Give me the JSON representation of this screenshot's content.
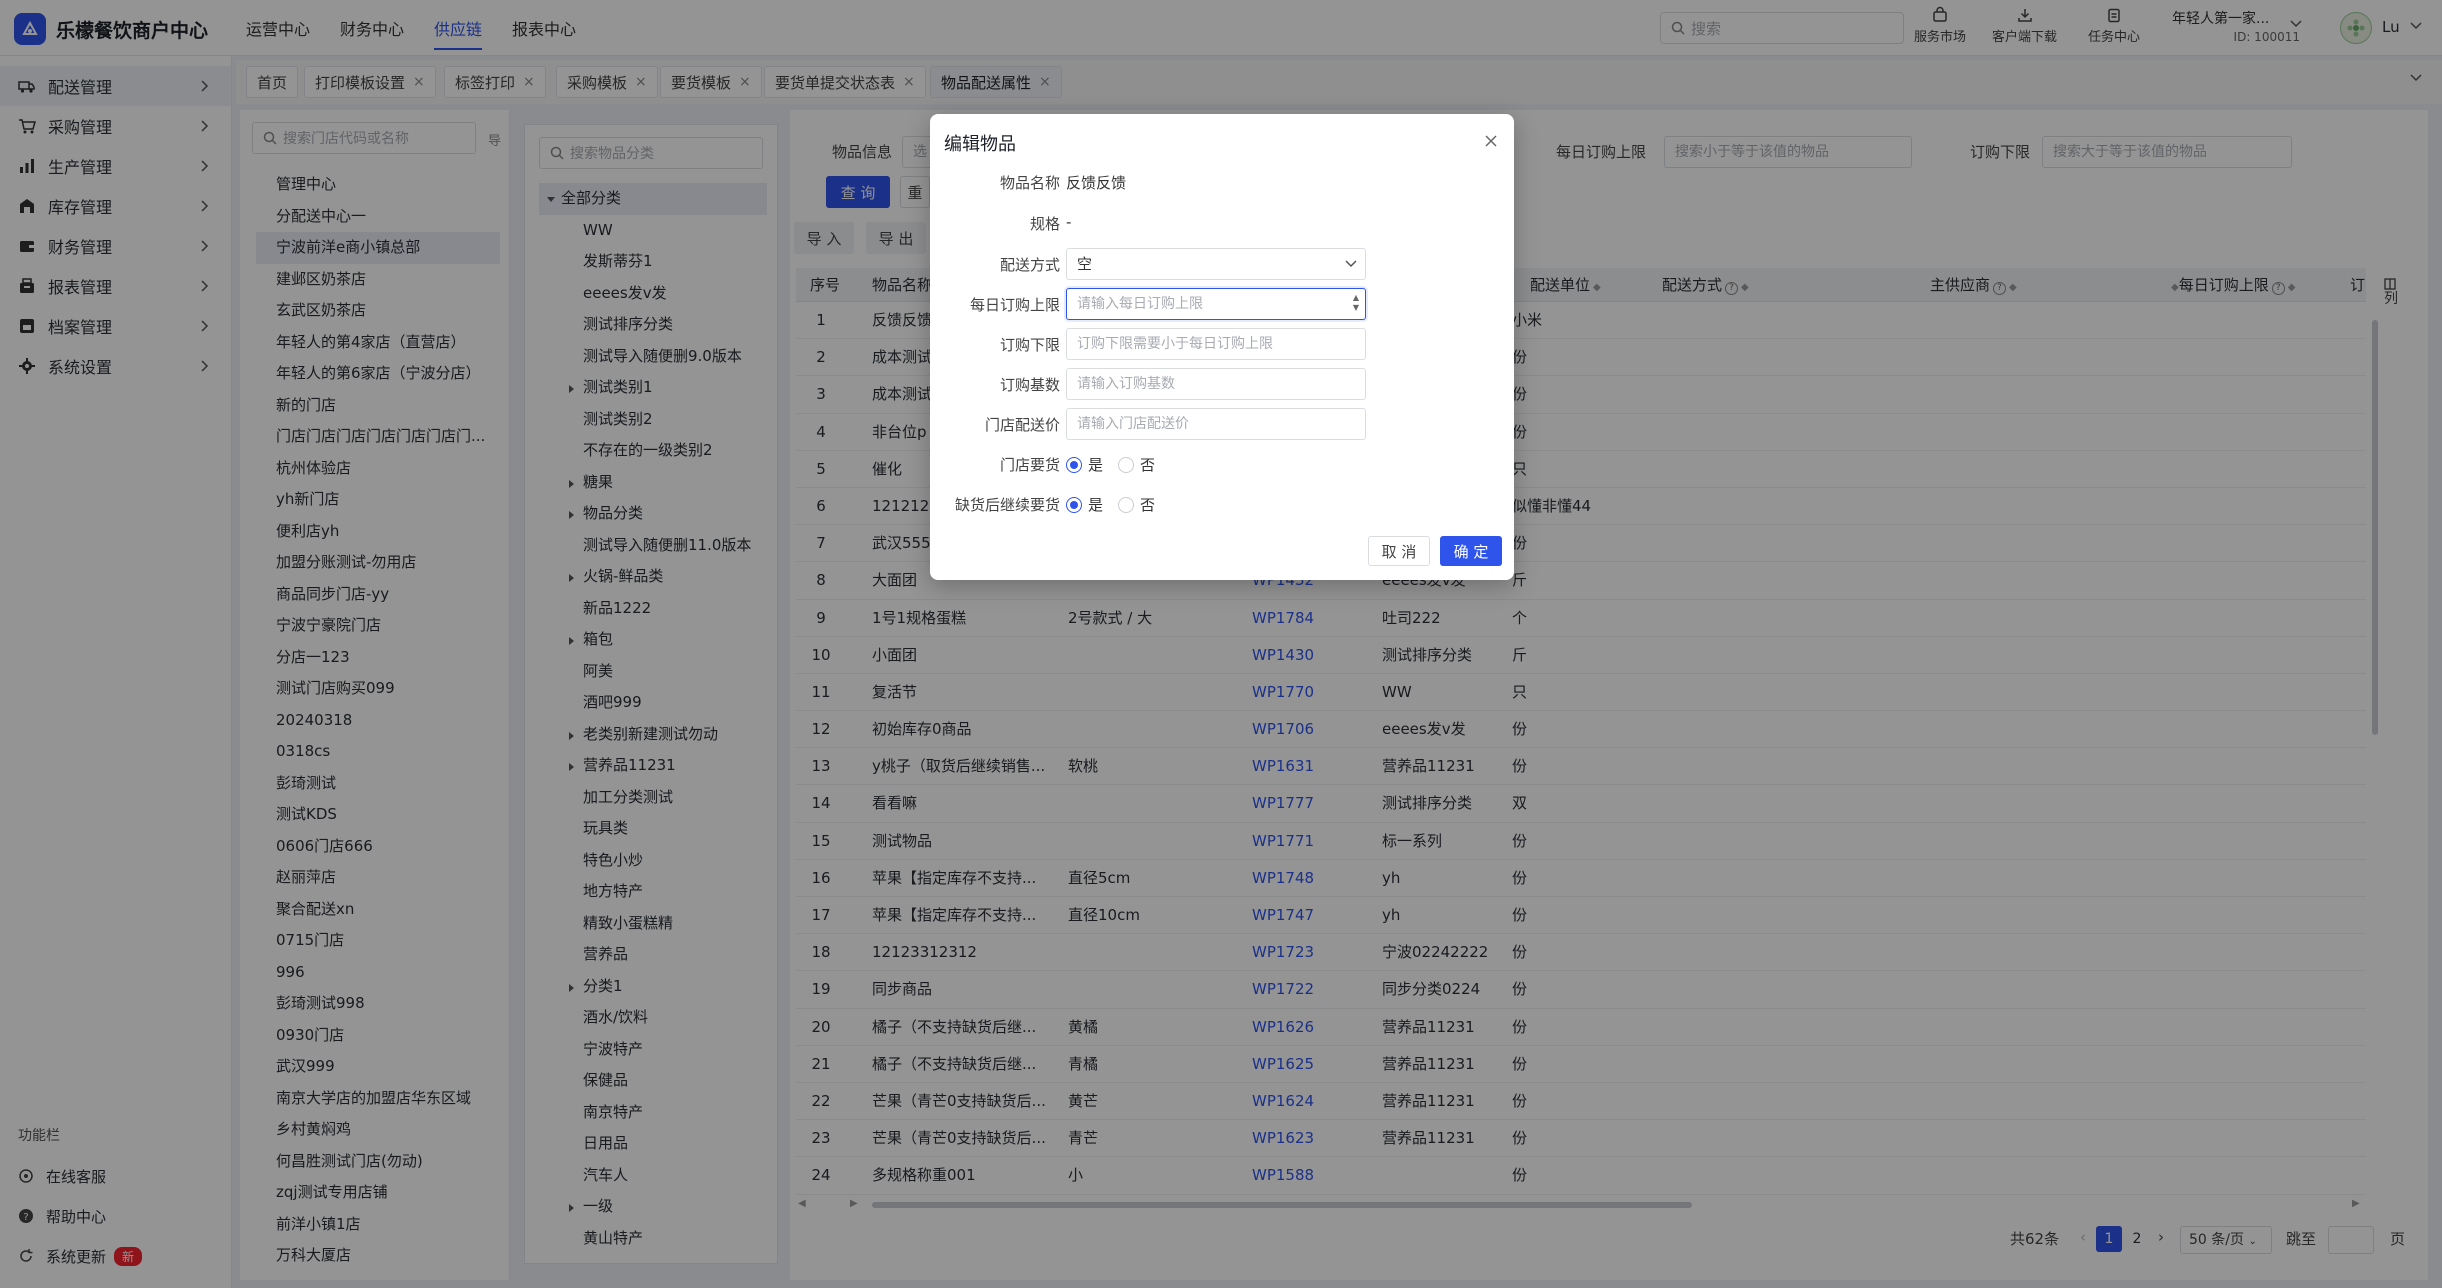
{
  "app": {
    "title": "乐檬餐饮商户中心"
  },
  "topnav": [
    "运营中心",
    "财务中心",
    "供应链",
    "报表中心"
  ],
  "top_active": "供应链",
  "search": {
    "placeholder": "搜索"
  },
  "tools": [
    {
      "label": "服务市场",
      "icon": "bag-icon"
    },
    {
      "label": "客户端下载",
      "icon": "download-icon"
    },
    {
      "label": "任务中心",
      "icon": "clipboard-icon"
    }
  ],
  "user": {
    "name": "年轻人第一家...",
    "id": "ID: 100011",
    "lang": "Lu"
  },
  "sidebar": {
    "items": [
      {
        "label": "配送管理",
        "icon": "truck-icon"
      },
      {
        "label": "采购管理",
        "icon": "cart-icon"
      },
      {
        "label": "生产管理",
        "icon": "chart-icon"
      },
      {
        "label": "库存管理",
        "icon": "warehouse-icon"
      },
      {
        "label": "财务管理",
        "icon": "wallet-icon"
      },
      {
        "label": "报表管理",
        "icon": "report-icon"
      },
      {
        "label": "档案管理",
        "icon": "archive-icon"
      },
      {
        "label": "系统设置",
        "icon": "gear-icon"
      }
    ],
    "footer_title": "功能栏",
    "footer": [
      {
        "label": "在线客服",
        "icon": "headset-icon"
      },
      {
        "label": "帮助中心",
        "icon": "help-icon"
      },
      {
        "label": "系统更新",
        "icon": "refresh-icon"
      }
    ],
    "new_badge": "新"
  },
  "tabs": [
    {
      "label": "首页",
      "closable": false
    },
    {
      "label": "打印模板设置",
      "closable": true
    },
    {
      "label": "标签打印",
      "closable": true
    },
    {
      "label": "采购模板",
      "closable": true
    },
    {
      "label": "要货模板",
      "closable": true
    },
    {
      "label": "要货单提交状态表",
      "closable": true
    },
    {
      "label": "物品配送属性",
      "closable": true,
      "active": true
    }
  ],
  "stores": {
    "placeholder": "搜索门店代码或名称",
    "toggle": "导",
    "items": [
      "管理中心",
      "分配送中心一",
      "宁波前洋e商小镇总部",
      "建邺区奶茶店",
      "玄武区奶茶店",
      "年轻人的第4家店（直营店）",
      "年轻人的第6家店（宁波分店）",
      "新的门店",
      "门店门店门店门店门店门店门...",
      "杭州体验店",
      "yh新门店",
      "便利店yh",
      "加盟分账测试-勿用店",
      "商品同步门店-yy",
      "宁波宁豪院门店",
      "分店一123",
      "测试门店购买099",
      "20240318",
      "0318cs",
      "彭琦测试",
      "测试KDS",
      "0606门店666",
      "赵丽萍店",
      "聚合配送xn",
      "0715门店",
      "996",
      "彭琦测试998",
      "0930门店",
      "武汉999",
      "南京大学店的加盟店华东区域",
      "乡村黄焖鸡",
      "何昌胜测试门店(勿动)",
      "zqj测试专用店铺",
      "前洋小镇1店",
      "万科大厦店"
    ],
    "selected": 2
  },
  "categories": {
    "placeholder": "搜索物品分类",
    "root": "全部分类",
    "items": [
      {
        "label": "WW",
        "expandable": false
      },
      {
        "label": "发斯蒂芬1",
        "expandable": false
      },
      {
        "label": "eeees发v发",
        "expandable": false
      },
      {
        "label": "测试排序分类",
        "expandable": false
      },
      {
        "label": "测试导入随便删9.0版本",
        "expandable": false
      },
      {
        "label": "测试类别1",
        "expandable": true
      },
      {
        "label": "测试类别2",
        "expandable": false
      },
      {
        "label": "不存在的一级类别2",
        "expandable": false
      },
      {
        "label": "糖果",
        "expandable": true
      },
      {
        "label": "物品分类",
        "expandable": true
      },
      {
        "label": "测试导入随便删11.0版本",
        "expandable": false
      },
      {
        "label": "火锅-鲜品类",
        "expandable": true
      },
      {
        "label": "新品1222",
        "expandable": false
      },
      {
        "label": "箱包",
        "expandable": true
      },
      {
        "label": "阿美",
        "expandable": false
      },
      {
        "label": "酒吧999",
        "expandable": false
      },
      {
        "label": "老类别新建测试勿动",
        "expandable": true
      },
      {
        "label": "营养品11231",
        "expandable": true
      },
      {
        "label": "加工分类测试",
        "expandable": false
      },
      {
        "label": "玩具类",
        "expandable": false
      },
      {
        "label": "特色小炒",
        "expandable": false
      },
      {
        "label": "地方特产",
        "expandable": false
      },
      {
        "label": "精致小蛋糕精",
        "expandable": false
      },
      {
        "label": "营养品",
        "expandable": false
      },
      {
        "label": "分类1",
        "expandable": true
      },
      {
        "label": "酒水/饮料",
        "expandable": false
      },
      {
        "label": "宁波特产",
        "expandable": false
      },
      {
        "label": "保健品",
        "expandable": false
      },
      {
        "label": "南京特产",
        "expandable": false
      },
      {
        "label": "日用品",
        "expandable": false
      },
      {
        "label": "汽车人",
        "expandable": false
      },
      {
        "label": "一级",
        "expandable": true
      },
      {
        "label": "黄山特产",
        "expandable": false
      }
    ]
  },
  "filters": {
    "item_info_label": "物品信息",
    "item_info_placeholder": "选",
    "daily_max_label": "每日订购上限",
    "daily_max_placeholder": "搜索小于等于该值的物品",
    "min_label": "订购下限",
    "min_placeholder": "搜索大于等于该值的物品",
    "query": "查 询",
    "reset": "重",
    "import": "导 入",
    "export": "导 出"
  },
  "table": {
    "headers": {
      "index": "序号",
      "name": "物品名称",
      "unit": "配送单位",
      "method": "配送方式",
      "supplier": "主供应商",
      "daily_max": "每日订购上限",
      "more": "订"
    },
    "col_settings": "列",
    "rows": [
      [
        "1",
        "反馈反馈",
        "",
        "",
        "",
        "小米"
      ],
      [
        "2",
        "成本测试",
        "",
        "",
        "",
        "份"
      ],
      [
        "3",
        "成本测试",
        "",
        "",
        "",
        "份"
      ],
      [
        "4",
        "非台位p",
        "",
        "",
        "",
        "份"
      ],
      [
        "5",
        "催化",
        "",
        "",
        "",
        "只"
      ],
      [
        "6",
        "121212",
        "",
        "",
        "",
        "似懂非懂44"
      ],
      [
        "7",
        "武汉555",
        "",
        "",
        "",
        "份"
      ],
      [
        "8",
        "大面团",
        "",
        "WP1432",
        "eeees发v发",
        "斤"
      ],
      [
        "9",
        "1号1规格蛋糕",
        "2号款式 / 大",
        "WP1784",
        "吐司222",
        "个"
      ],
      [
        "10",
        "小面团",
        "",
        "WP1430",
        "测试排序分类",
        "斤"
      ],
      [
        "11",
        "复活节",
        "",
        "WP1770",
        "WW",
        "只"
      ],
      [
        "12",
        "初始库存0商品",
        "",
        "WP1706",
        "eeees发v发",
        "份"
      ],
      [
        "13",
        "y桃子（取货后继续销售...",
        "软桃",
        "WP1631",
        "营养品11231",
        "份"
      ],
      [
        "14",
        "看看嘛",
        "",
        "WP1777",
        "测试排序分类",
        "双"
      ],
      [
        "15",
        "测试物品",
        "",
        "WP1771",
        "标一系列",
        "份"
      ],
      [
        "16",
        "苹果【指定库存不支持...",
        "直径5cm",
        "WP1748",
        "yh",
        "份"
      ],
      [
        "17",
        "苹果【指定库存不支持...",
        "直径10cm",
        "WP1747",
        "yh",
        "份"
      ],
      [
        "18",
        "12123312312",
        "",
        "WP1723",
        "宁波02242222",
        "份"
      ],
      [
        "19",
        "同步商品",
        "",
        "WP1722",
        "同步分类0224",
        "份"
      ],
      [
        "20",
        "橘子（不支持缺货后继...",
        "黄橘",
        "WP1626",
        "营养品11231",
        "份"
      ],
      [
        "21",
        "橘子（不支持缺货后继...",
        "青橘",
        "WP1625",
        "营养品11231",
        "份"
      ],
      [
        "22",
        "芒果（青芒0支持缺货后...",
        "黄芒",
        "WP1624",
        "营养品11231",
        "份"
      ],
      [
        "23",
        "芒果（青芒0支持缺货后...",
        "青芒",
        "WP1623",
        "营养品11231",
        "份"
      ],
      [
        "24",
        "多规格称重001",
        "小",
        "WP1588",
        "",
        "份"
      ]
    ]
  },
  "pagination": {
    "total": "共62条",
    "pages": [
      "1",
      "2"
    ],
    "current": "1",
    "page_size": "50 条/页",
    "jump_label": "跳至",
    "page_suffix": "页"
  },
  "modal": {
    "title": "编辑物品",
    "fields": {
      "name_label": "物品名称",
      "name_value": "反馈反馈",
      "spec_label": "规格",
      "spec_value": "-",
      "method_label": "配送方式",
      "method_value": "空",
      "daily_max_label": "每日订购上限",
      "daily_max_placeholder": "请输入每日订购上限",
      "min_label": "订购下限",
      "min_placeholder": "订购下限需要小于每日订购上限",
      "base_label": "订购基数",
      "base_placeholder": "请输入订购基数",
      "price_label": "门店配送价",
      "price_placeholder": "请输入门店配送价",
      "request_label": "门店要货",
      "continue_label": "缺货后继续要货"
    },
    "yes": "是",
    "no": "否",
    "request_value": "是",
    "continue_value": "是",
    "cancel": "取 消",
    "confirm": "确 定"
  },
  "colors": {
    "accent": "#2f54eb",
    "danger": "#f5222d"
  }
}
